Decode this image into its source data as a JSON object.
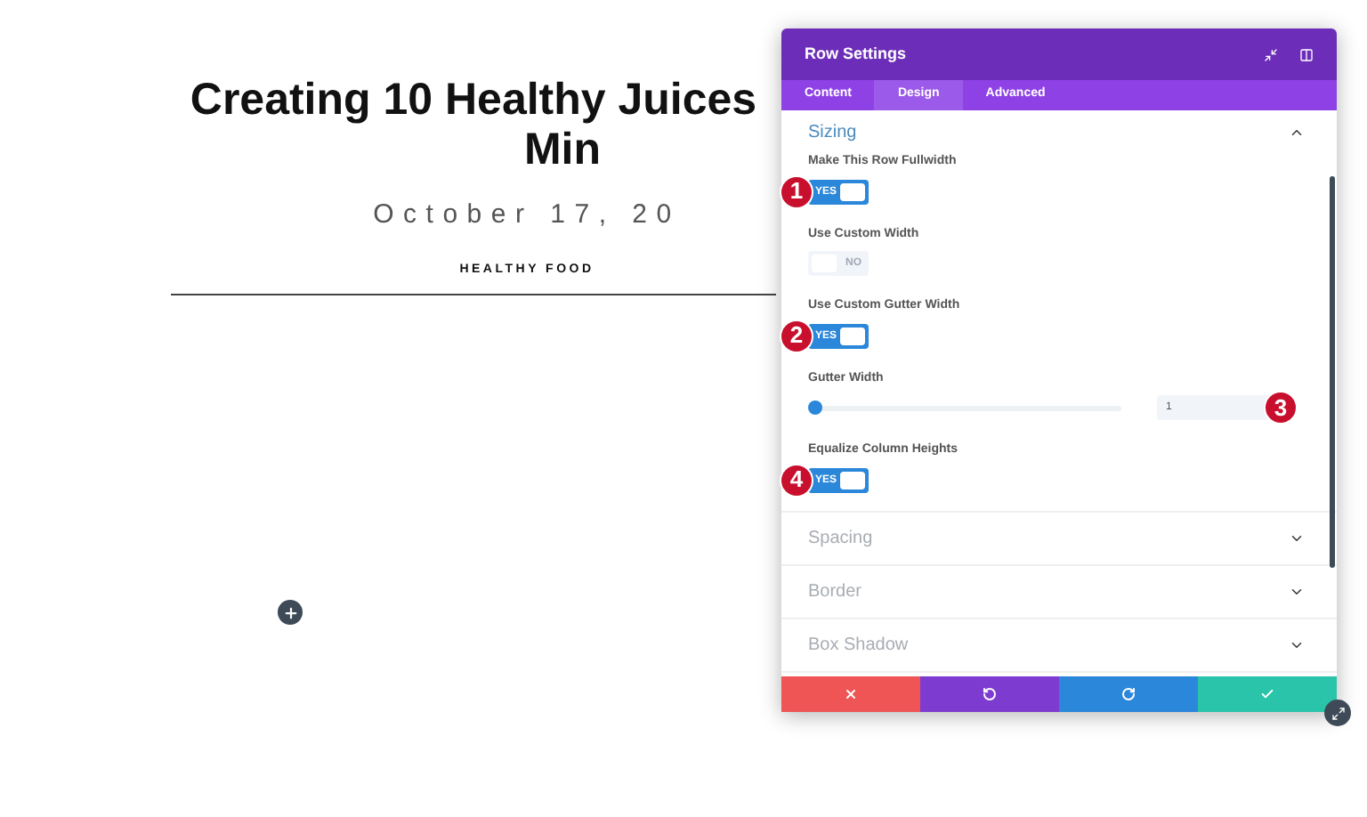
{
  "article": {
    "title_lines": [
      "Creating 10 Healthy Juices",
      "Min"
    ],
    "date": "October 17, 20",
    "category": "HEALTHY FOOD"
  },
  "modal": {
    "title": "Row Settings",
    "tabs": [
      {
        "label": "Content",
        "selected": false
      },
      {
        "label": "Design",
        "selected": true
      },
      {
        "label": "Advanced",
        "selected": false
      }
    ],
    "sections": [
      {
        "title": "Sizing",
        "expanded": true,
        "fields": [
          {
            "kind": "toggle",
            "label": "Make This Row Fullwidth",
            "on": true,
            "text": "YES",
            "marker": "1"
          },
          {
            "kind": "toggle",
            "label": "Use Custom Width",
            "on": false,
            "text": "NO"
          },
          {
            "kind": "toggle",
            "label": "Use Custom Gutter Width",
            "on": true,
            "text": "YES",
            "marker": "2"
          },
          {
            "kind": "slider",
            "label": "Gutter Width",
            "level": 0.02,
            "value": "1",
            "marker": "3"
          },
          {
            "kind": "toggle",
            "label": "Equalize Column Heights",
            "on": true,
            "text": "YES",
            "marker": "4"
          }
        ]
      },
      {
        "title": "Spacing",
        "expanded": false
      },
      {
        "title": "Border",
        "expanded": false
      },
      {
        "title": "Box Shadow",
        "expanded": false
      }
    ]
  }
}
